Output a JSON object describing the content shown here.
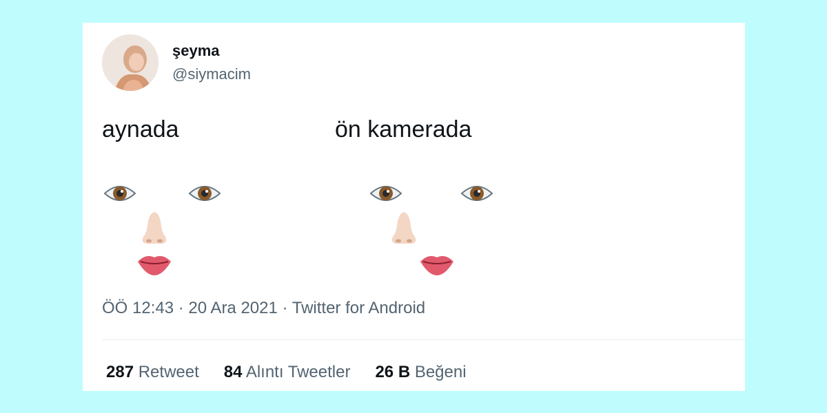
{
  "tweet": {
    "user": {
      "name": "şeyma",
      "handle": "@siymacim"
    },
    "content": {
      "left_label": "aynada",
      "right_label": "ön kamerada"
    },
    "meta": "ÖÖ 12:43 · 20 Ara 2021 · Twitter for Android",
    "stats": [
      {
        "count": "287",
        "label": "Retweet"
      },
      {
        "count": "84",
        "label": "Alıntı Tweetler"
      },
      {
        "count": "26 B",
        "label": "Beğeni"
      }
    ]
  },
  "colors": {
    "background": "#bffcfd",
    "card": "#ffffff",
    "secondary_text": "#536471",
    "primary_text": "#0f1419",
    "lips": "#e05a6c"
  },
  "icons": [
    "eye-icon",
    "nose-icon",
    "lips-icon"
  ]
}
